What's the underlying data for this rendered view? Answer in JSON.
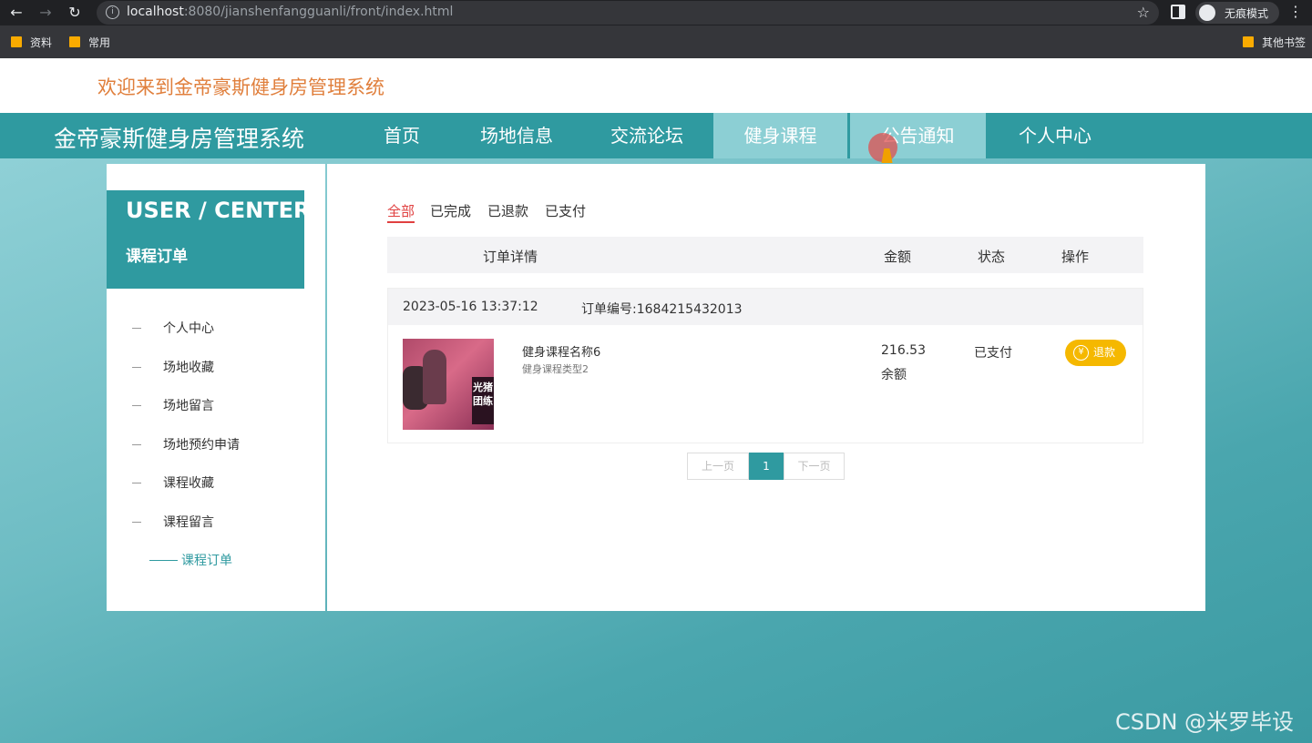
{
  "browser": {
    "url_host": "localhost",
    "url_rest": ":8080/jianshenfangguanli/front/index.html",
    "incognito_label": "无痕模式",
    "bookmarks": [
      "资料",
      "常用"
    ],
    "other_bookmarks": "其他书签"
  },
  "header": {
    "welcome": "欢迎来到金帝豪斯健身房管理系统"
  },
  "navbar": {
    "brand": "金帝豪斯健身房管理系统",
    "items": [
      "首页",
      "场地信息",
      "交流论坛",
      "健身课程",
      "公告通知",
      "个人中心"
    ],
    "active_index": 3
  },
  "sidebar": {
    "title": "USER / CENTER",
    "subtitle": "课程订单",
    "items": [
      "个人中心",
      "场地收藏",
      "场地留言",
      "场地预约申请",
      "课程收藏",
      "课程留言",
      "课程订单"
    ],
    "current": "课程订单"
  },
  "content": {
    "tabs": [
      "全部",
      "已完成",
      "已退款",
      "已支付"
    ],
    "active_tab": "全部",
    "columns": {
      "detail": "订单详情",
      "amount": "金额",
      "status": "状态",
      "action": "操作"
    },
    "orders": [
      {
        "date": "2023-05-16 13:37:12",
        "order_no": "订单编号:1684215432013",
        "course_name": "健身课程名称6",
        "course_type": "健身课程类型2",
        "price": "216.53",
        "pay_method": "余额",
        "status": "已支付",
        "action": "退款",
        "action_icon": "¥",
        "thumb_text": "光猪团练"
      }
    ],
    "pagination": {
      "prev": "上一页",
      "current": "1",
      "next": "下一页"
    }
  },
  "watermark": "CSDN @米罗毕设",
  "colors": {
    "primary": "#2f9aa0",
    "active_nav": "#8ccfd4",
    "welcome": "#e07f3c",
    "refund": "#f5b800",
    "active_tab": "#e04040"
  }
}
